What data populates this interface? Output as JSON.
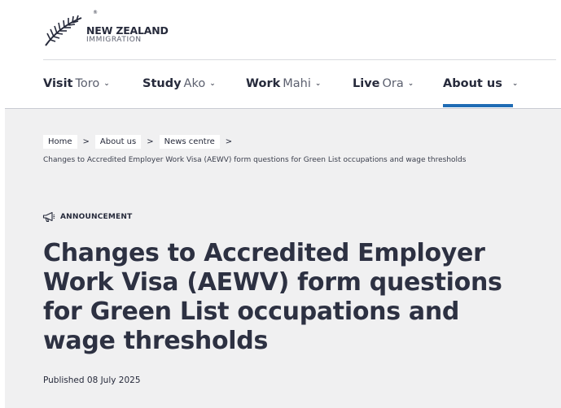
{
  "logo": {
    "mark": "®",
    "line1": "NEW ZEALAND",
    "line2": "IMMIGRATION"
  },
  "nav": {
    "items": [
      {
        "en": "Visit",
        "mi": "Toro"
      },
      {
        "en": "Study",
        "mi": "Ako"
      },
      {
        "en": "Work",
        "mi": "Mahi"
      },
      {
        "en": "Live",
        "mi": "Ora"
      },
      {
        "en": "About us",
        "mi": ""
      }
    ],
    "active_index": 4,
    "active_color": "#1f6cb5"
  },
  "breadcrumb": {
    "items": [
      "Home",
      "About us",
      "News centre"
    ],
    "current": "Changes to Accredited Employer Work Visa (AEWV) form questions for Green List occupations and wage thresholds"
  },
  "article": {
    "type_icon": "megaphone-icon",
    "type_label": "ANNOUNCEMENT",
    "title": "Changes to Accredited Employer Work Visa (AEWV) form questions for Green List occupations and wage thresholds",
    "published": "Published 08 July 2025"
  }
}
